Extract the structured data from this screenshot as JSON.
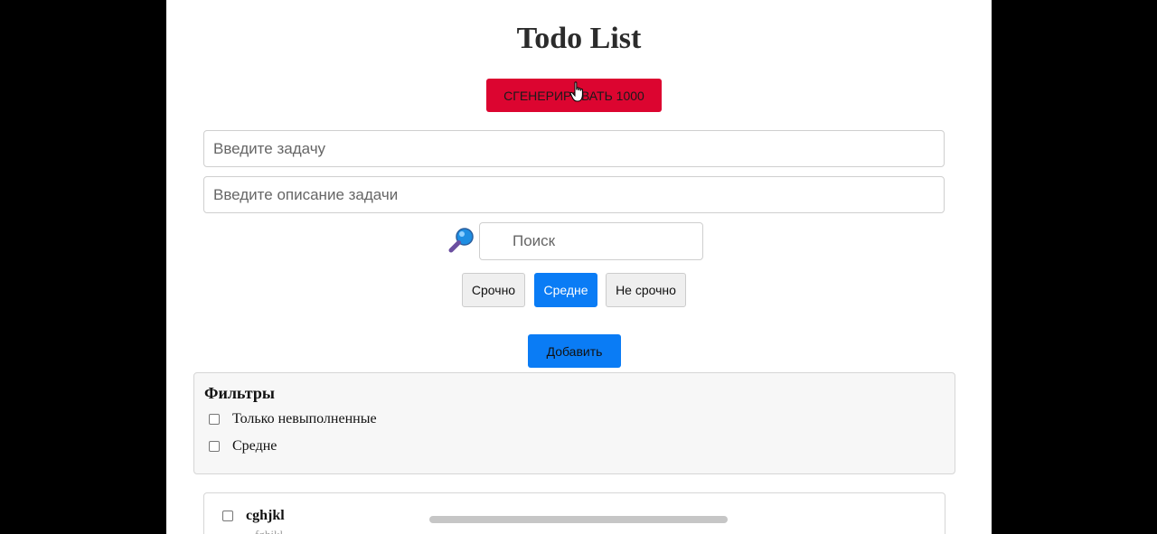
{
  "app": {
    "title": "Todo List",
    "generate_button": "СГЕНЕРИРОВАТЬ 1000"
  },
  "form": {
    "task_placeholder": "Введите задачу",
    "task_value": "",
    "description_placeholder": "Введите описание задачи",
    "description_value": "",
    "search_placeholder": "Поиск",
    "search_value": "",
    "search_icon": "magnifying-glass-icon",
    "priorities": [
      {
        "label": "Срочно",
        "selected": false
      },
      {
        "label": "Средне",
        "selected": true
      },
      {
        "label": "Не срочно",
        "selected": false
      }
    ],
    "add_button": "Добавить"
  },
  "filters": {
    "title": "Фильтры",
    "items": [
      {
        "label": "Только невыполненные",
        "checked": false
      },
      {
        "label": "Средне",
        "checked": false
      }
    ]
  },
  "tasks": [
    {
      "title": "cghjkl",
      "description": "fghjkl",
      "done": false
    }
  ],
  "colors": {
    "generate_button": "#dc0530",
    "accent": "#0a7cf5",
    "background": "#000000",
    "page": "#ffffff"
  }
}
